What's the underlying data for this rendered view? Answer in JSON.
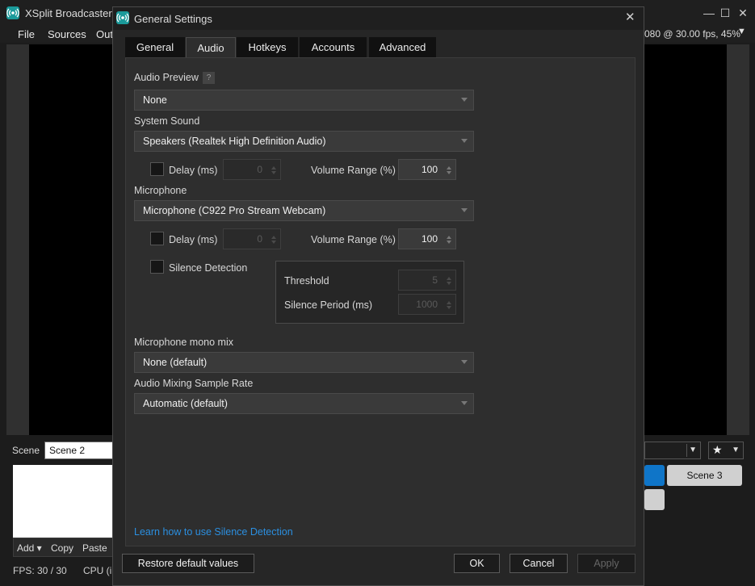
{
  "main_window": {
    "title": "XSplit Broadcaster",
    "controls": {
      "minimize": "—",
      "maximize": "☐",
      "close": "✕"
    },
    "menu": [
      "File",
      "Sources",
      "Out"
    ],
    "status": "080 @ 30.00 fps, 45%",
    "scene_label": "Scene",
    "scene_name": "Scene 2",
    "source_actions": {
      "add": "Add ▾",
      "copy": "Copy",
      "paste": "Paste"
    },
    "fps_text": "FPS:  30 / 30",
    "cpu_text": "CPU (i",
    "scene_tile": "Scene 3"
  },
  "dialog": {
    "title": "General Settings",
    "close": "✕",
    "tabs": [
      {
        "label": "General",
        "active": false
      },
      {
        "label": "Audio",
        "active": true
      },
      {
        "label": "Hotkeys",
        "active": false
      },
      {
        "label": "Accounts",
        "active": false
      },
      {
        "label": "Advanced",
        "active": false
      }
    ],
    "audio_preview": {
      "label": "Audio Preview",
      "help": "?",
      "value": "None"
    },
    "system_sound": {
      "label": "System Sound",
      "value": "Speakers (Realtek High Definition Audio)",
      "delay_label": "Delay (ms)",
      "delay_checked": false,
      "delay_value": "0",
      "volume_label": "Volume Range (%)",
      "volume_value": "100"
    },
    "microphone": {
      "label": "Microphone",
      "value": "Microphone (C922 Pro Stream Webcam)",
      "delay_label": "Delay (ms)",
      "delay_checked": false,
      "delay_value": "0",
      "volume_label": "Volume Range (%)",
      "volume_value": "100",
      "silence_label": "Silence Detection",
      "silence_checked": false,
      "threshold_label": "Threshold",
      "threshold_value": "5",
      "silence_period_label": "Silence Period (ms)",
      "silence_period_value": "1000"
    },
    "mono_mix": {
      "label": "Microphone mono mix",
      "value": "None (default)"
    },
    "sample_rate": {
      "label": "Audio Mixing Sample Rate",
      "value": "Automatic (default)"
    },
    "help_link": "Learn how to use Silence Detection",
    "buttons": {
      "restore": "Restore default values",
      "ok": "OK",
      "cancel": "Cancel",
      "apply": "Apply"
    }
  },
  "colors": {
    "accent_link": "#2b8fe0",
    "app_icon": "#1a9a9a",
    "scene_active": "#0f75c8"
  }
}
